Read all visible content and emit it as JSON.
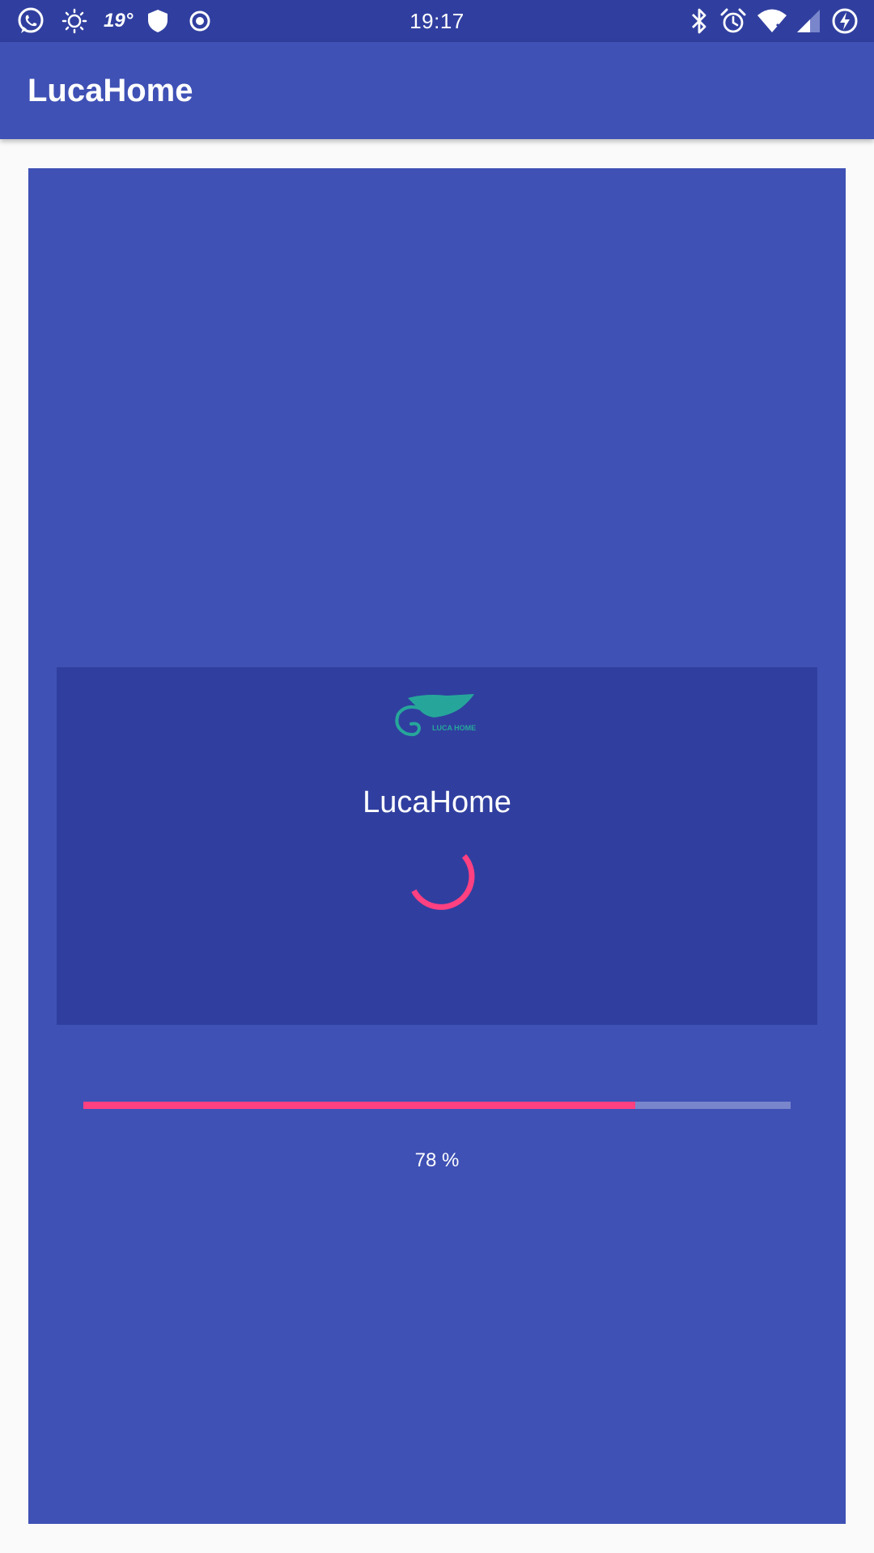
{
  "status_bar": {
    "time": "19:17",
    "temperature": "19°",
    "left_icons": [
      "whatsapp-icon",
      "brightness-icon",
      "shield-icon",
      "record-icon"
    ],
    "right_icons": [
      "bluetooth-icon",
      "alarm-icon",
      "wifi-icon",
      "cell-signal-icon",
      "battery-charging-icon"
    ]
  },
  "app_bar": {
    "title": "LucaHome"
  },
  "loading": {
    "logo_text": "LUCA HOME",
    "title": "LucaHome",
    "progress_percent": 78,
    "progress_label": "78 %"
  },
  "colors": {
    "primary": "#3F51B5",
    "primary_dark": "#303F9F",
    "accent": "#FF4081",
    "logo": "#26A69A",
    "progress_track": "#7986CB",
    "background": "#FAFAFA"
  }
}
